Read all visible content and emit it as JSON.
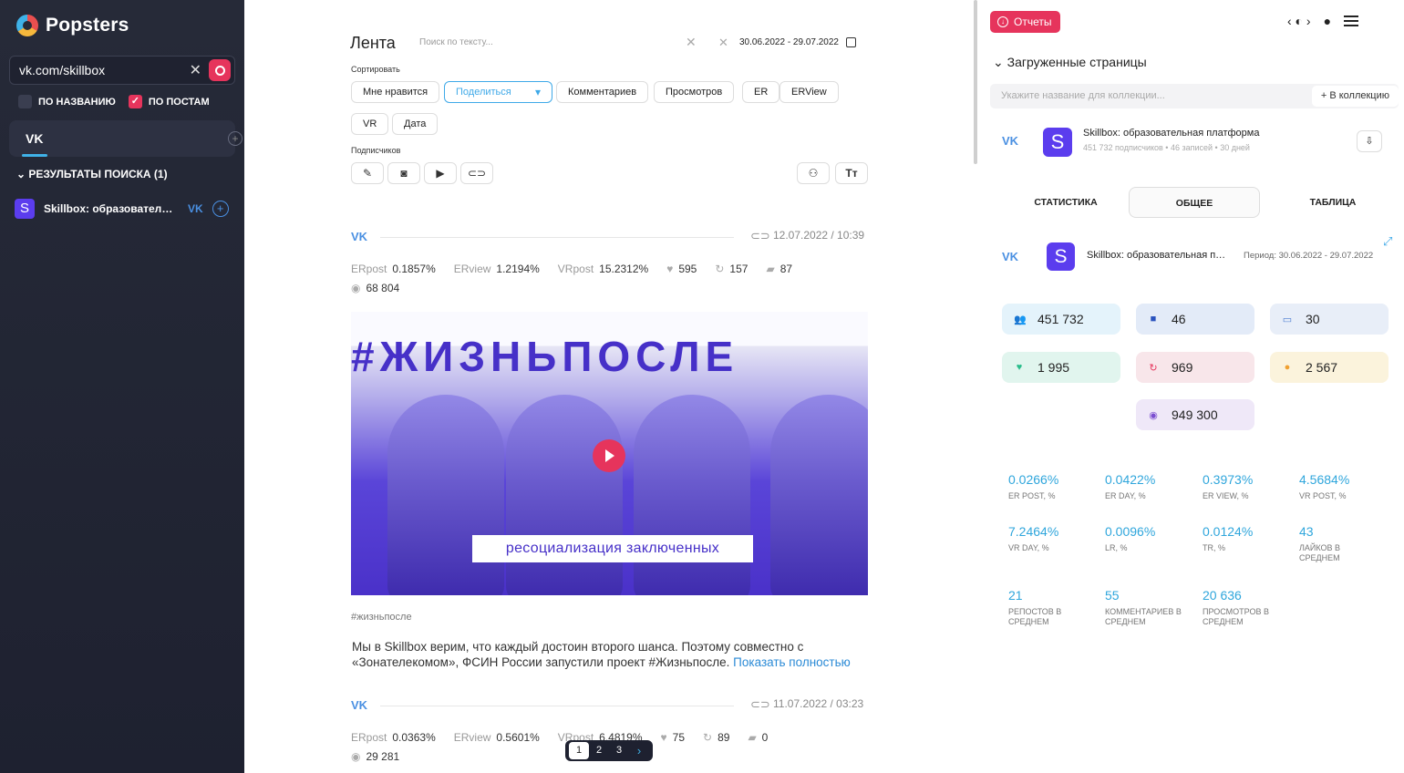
{
  "app": {
    "logo": "Popsters"
  },
  "sidebar": {
    "search_value": "vk.com/skillbox",
    "check_by_name": "ПО НАЗВАНИЮ",
    "check_by_posts": "ПО ПОСТАМ",
    "network_tab": "VK",
    "results_heading": "РЕЗУЛЬТАТЫ ПОИСКА (1)",
    "result_name": "Skillbox: образовательная платформа",
    "result_avatar": "S",
    "result_network": "VK"
  },
  "feed": {
    "title": "Лента",
    "search_placeholder": "Поиск по тексту...",
    "date_range": "30.06.2022 - 29.07.2022",
    "sort_label": "Сортировать",
    "sort_options": [
      "Мне нравится",
      "Поделиться",
      "Комментариев",
      "Просмотров",
      "ER",
      "ERView",
      "VR",
      "Дата"
    ],
    "subscribers_label": "Подписчиков",
    "posts": [
      {
        "network": "VK",
        "date": "12.07.2022 / 10:39",
        "erpost_label": "ERpost",
        "erpost": "0.1857%",
        "erview_label": "ERview",
        "erview": "1.2194%",
        "vrpost_label": "VRpost",
        "vrpost": "15.2312%",
        "likes": "595",
        "reposts": "157",
        "comments": "87",
        "views": "68 804",
        "media_headline": "#ЖИЗНЬПОСЛЕ",
        "media_caption": "ресоциализация заключенных",
        "hashtag": "#жизньпосле",
        "text": "Мы в Skillbox верим, что каждый достоин второго шанса. Поэтому совместно с «Зонателекомом», ФСИН России запустили проект #Жизньпосле.",
        "more": "Показать полностью"
      },
      {
        "network": "VK",
        "date": "11.07.2022 / 03:23",
        "erpost_label": "ERpost",
        "erpost": "0.0363%",
        "erview_label": "ERview",
        "erview": "0.5601%",
        "vrpost_label": "VRpost",
        "vrpost": "6.4819%",
        "likes": "75",
        "reposts": "89",
        "comments": "0",
        "views": "29 281"
      }
    ],
    "pagination": [
      "1",
      "2",
      "3"
    ]
  },
  "right": {
    "reports_label": "Отчеты",
    "loaded_pages_title": "Загруженные страницы",
    "collection_placeholder": "Укажите название для коллекции...",
    "add_to_collection": "+ В коллекцию",
    "page": {
      "avatar": "S",
      "name": "Skillbox: образовательная платформа",
      "meta": "451 732 подписчиков • 46 записей • 30 дней"
    },
    "tabs": [
      "СТАТИСТИКА",
      "ОБЩЕЕ",
      "ТАБЛИЦА"
    ],
    "active_tab": "ОБЩЕЕ",
    "summary_name": "Skillbox: образовательная платформа",
    "period": "Период: 30.06.2022 - 29.07.2022",
    "cards": {
      "subscribers": "451 732",
      "posts": "46",
      "days": "30",
      "likes": "1 995",
      "reposts": "969",
      "comments": "2 567",
      "views": "949 300"
    },
    "metrics": [
      {
        "value": "0.0266%",
        "label": "ER POST, %"
      },
      {
        "value": "0.0422%",
        "label": "ER DAY, %"
      },
      {
        "value": "0.3973%",
        "label": "ER VIEW, %"
      },
      {
        "value": "4.5684%",
        "label": "VR POST, %"
      },
      {
        "value": "7.2464%",
        "label": "VR DAY, %"
      },
      {
        "value": "0.0096%",
        "label": "LR, %"
      },
      {
        "value": "0.0124%",
        "label": "TR, %"
      },
      {
        "value": "43",
        "label": "ЛАЙКОВ В СРЕДНЕМ"
      },
      {
        "value": "21",
        "label": "РЕПОСТОВ В СРЕДНЕМ"
      },
      {
        "value": "55",
        "label": "КОММЕНТАРИЕВ В СРЕДНЕМ"
      },
      {
        "value": "20 636",
        "label": "ПРОСМОТРОВ В СРЕДНЕМ"
      }
    ]
  },
  "colors": {
    "accent": "#e6345c",
    "link": "#3fa9e8",
    "vk": "#4a90e2",
    "sidebar_bg": "#262a38"
  }
}
